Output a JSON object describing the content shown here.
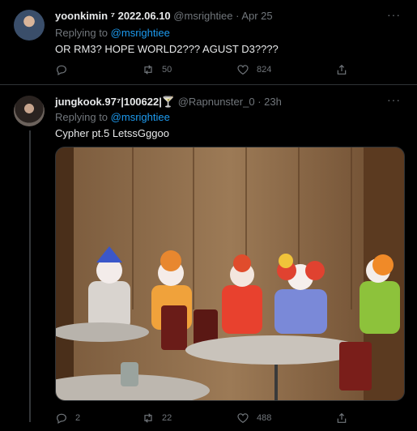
{
  "tweets": [
    {
      "name": "yoonkimin ⁷ 2022.06.10",
      "handle": "@msrightiee",
      "time": "Apr 25",
      "replying_prefix": "Replying to",
      "replying_to": "@msrightiee",
      "text": "OR RM3? HOPE WORLD2??? AGUST D3????",
      "replies": "",
      "retweets": "50",
      "likes": "824"
    },
    {
      "name": "jungkook.97⁷|100622|🍸",
      "handle": "@Rapnunster_0",
      "time": "23h",
      "replying_prefix": "Replying to",
      "replying_to": "@msrightiee",
      "text": "Cypher pt.5 LetssGggoo",
      "media_description_icon": "photo-clowns-sitting-at-tables",
      "replies": "2",
      "retweets": "22",
      "likes": "488"
    }
  ],
  "ui": {
    "more_glyph": "···",
    "dot": "·"
  },
  "colors": {
    "background": "#000000",
    "link": "#1d9bf0",
    "muted": "#71767b",
    "text": "#e7e9ea"
  }
}
